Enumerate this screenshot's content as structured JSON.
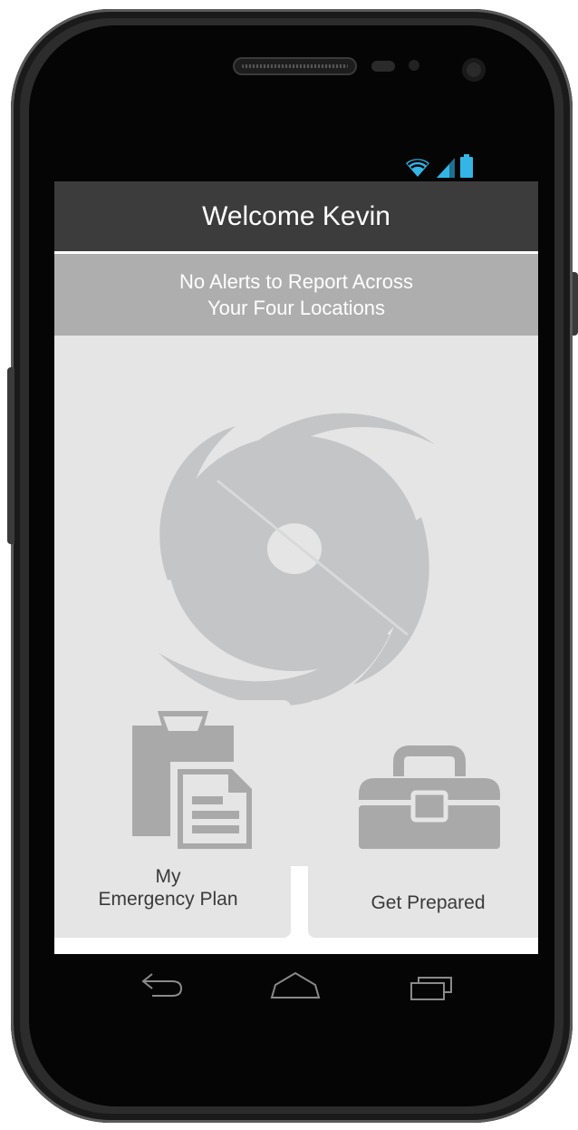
{
  "header": {
    "title": "Welcome Kevin"
  },
  "alert": {
    "line1": "No Alerts to Report Across",
    "line2": "Your Four Locations"
  },
  "hero": {
    "icon": "hurricane-icon"
  },
  "tiles": [
    {
      "line1": "My",
      "line2": "Emergency Plan",
      "icon": "clipboard-document-icon"
    },
    {
      "label": "Get Prepared",
      "icon": "toolbox-icon"
    }
  ],
  "status_bar": {
    "icons": [
      "wifi-icon",
      "signal-icon",
      "battery-icon"
    ],
    "accent": "#33b5e5"
  },
  "nav_bar": {
    "buttons": [
      "back-icon",
      "home-icon",
      "recent-apps-icon"
    ]
  },
  "colors": {
    "header_bg": "#3c3c3c",
    "alert_bg": "#aeaeae",
    "tile_bg": "#e5e5e5",
    "icon_gray": "#a9a9a9"
  }
}
